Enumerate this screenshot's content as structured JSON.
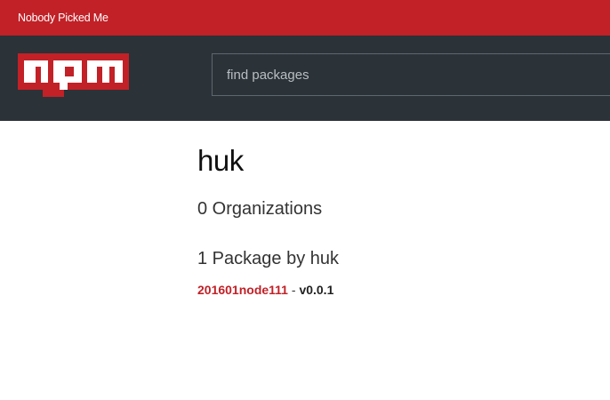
{
  "topbar": {
    "text": "Nobody Picked Me"
  },
  "header": {
    "logo_text": "npm",
    "brand_color": "#c12127",
    "background_color": "#2b3238",
    "search": {
      "placeholder": "find packages",
      "value": ""
    }
  },
  "profile": {
    "username": "huk",
    "organizations_text": "0 Organizations",
    "packages_heading": "1 Package by huk",
    "packages": [
      {
        "name": "201601node111",
        "separator": " - ",
        "version": "v0.0.1"
      }
    ]
  }
}
